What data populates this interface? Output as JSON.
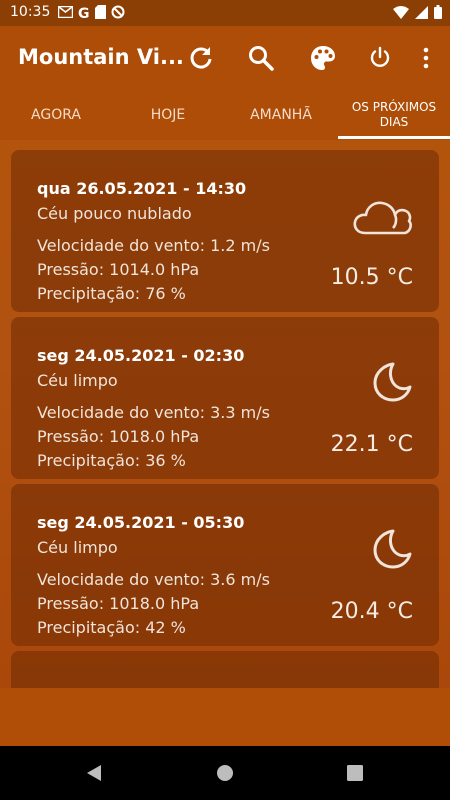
{
  "status_bar": {
    "time": "10:35",
    "left_icons": [
      "gmail-icon",
      "google-icon",
      "sd-card-icon",
      "do-not-disturb-icon"
    ],
    "right_icons": [
      "wifi-icon",
      "signal-icon",
      "battery-icon"
    ]
  },
  "app_bar": {
    "title": "Mountain Vi...",
    "actions": [
      "refresh-icon",
      "search-icon",
      "palette-icon",
      "power-icon",
      "more-icon"
    ]
  },
  "tabs": [
    {
      "label": "AGORA",
      "active": false
    },
    {
      "label": "HOJE",
      "active": false
    },
    {
      "label": "AMANHÃ",
      "active": false
    },
    {
      "label": "OS PRÓXIMOS DIAS",
      "active": true
    }
  ],
  "forecasts": [
    {
      "date": "qua 26.05.2021 - 14:30",
      "description": "Céu pouco nublado",
      "wind": "Velocidade do vento: 1.2 m/s",
      "pressure": "Pressão: 1014.0 hPa",
      "precipitation": "Precipitação: 76 %",
      "temperature": "10.5 °C",
      "icon": "cloud-icon"
    },
    {
      "date": "seg 24.05.2021 - 02:30",
      "description": "Céu limpo",
      "wind": "Velocidade do vento: 3.3 m/s",
      "pressure": "Pressão: 1018.0 hPa",
      "precipitation": "Precipitação: 36 %",
      "temperature": "22.1 °C",
      "icon": "moon-icon"
    },
    {
      "date": "seg 24.05.2021 - 05:30",
      "description": "Céu limpo",
      "wind": "Velocidade do vento: 3.6 m/s",
      "pressure": "Pressão: 1018.0 hPa",
      "precipitation": "Precipitação: 42 %",
      "temperature": "20.4 °C",
      "icon": "moon-icon"
    }
  ],
  "colors": {
    "primary": "#ad4d08",
    "status_bar": "#8c3f05",
    "card": "#6e2a04"
  }
}
